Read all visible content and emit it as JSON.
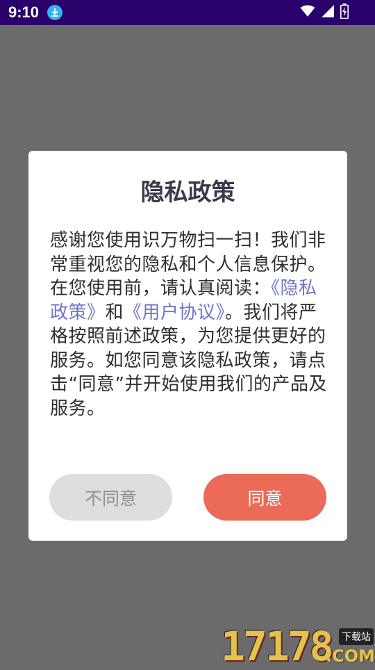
{
  "status_bar": {
    "time": "9:10",
    "icons": [
      "download-icon",
      "wifi-icon",
      "signal-icon",
      "battery-icon"
    ]
  },
  "dialog": {
    "title": "隐私政策",
    "body_text_1": "感谢您使用识万物扫一扫！我们非常重视您的隐私和个人信息保护。在您使用前，请认真阅读：",
    "privacy_link": "《隐私政策》",
    "and_text": "和",
    "agreement_link": "《用户协议》",
    "body_text_2": "。我们将严格按照前述政策，为您提供更好的服务。如您同意该隐私政策，请点击“同意”并开始使用我们的产品及服务。",
    "disagree_label": "不同意",
    "agree_label": "同意"
  },
  "watermark": {
    "digits": "17178",
    "tag": "下载站",
    "domain": ".COM"
  },
  "colors": {
    "status_bar": "#2a006b",
    "overlay": "#6b6b6b",
    "link": "#6f74c8",
    "agree_button": "#eb6b58",
    "disagree_button": "#dedede"
  }
}
